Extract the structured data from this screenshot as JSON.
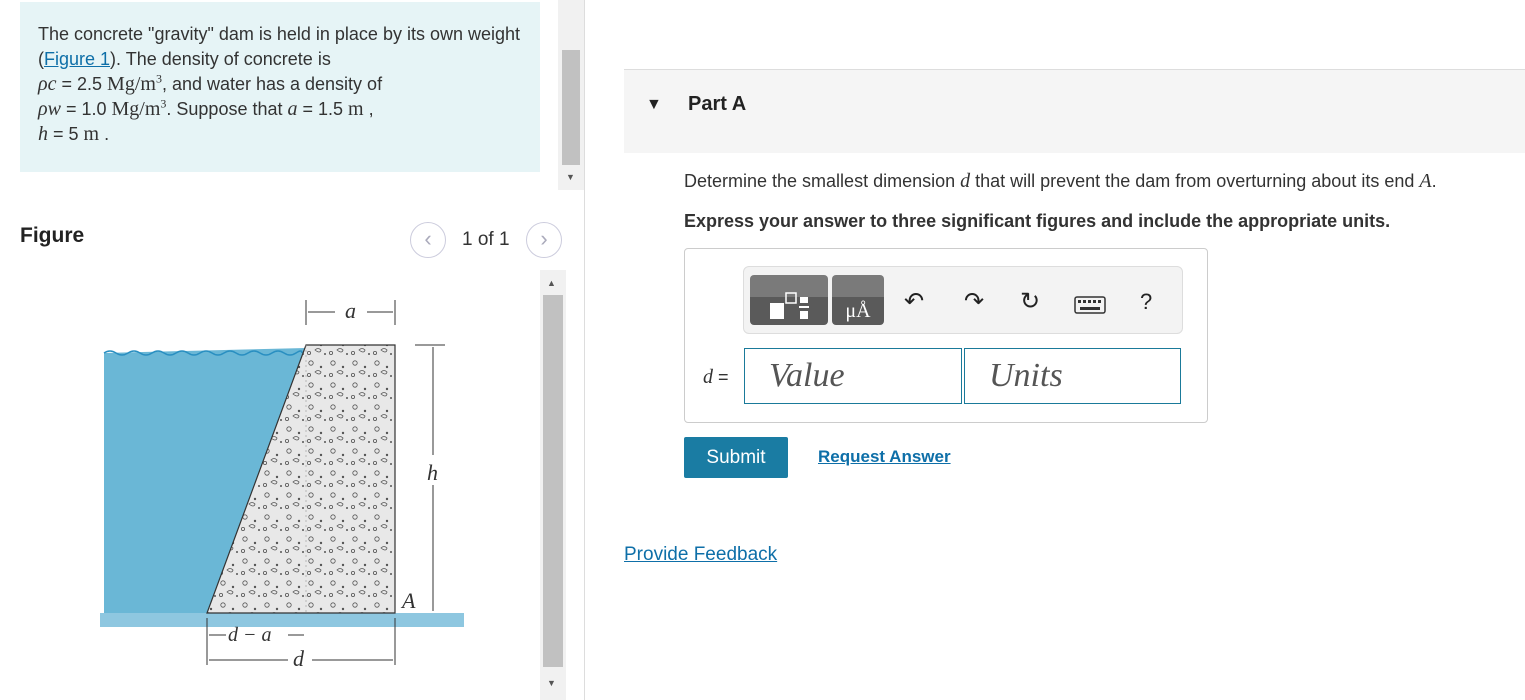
{
  "problem": {
    "text_1": "The concrete \"gravity\" dam is held in place by its own weight (",
    "figure_link": "Figure 1",
    "text_2": "). The density of concrete is",
    "rho_c_label": "ρc",
    "rho_c_value": " = 2.5 ",
    "rho_c_unit": "Mg/m",
    "rho_c_tail": ", and water has a density of",
    "rho_w_label": "ρw",
    "rho_w_value": " = 1.0 ",
    "rho_w_unit": "Mg/m",
    "rho_w_tail": ". Suppose that ",
    "a_var": "a",
    "a_value": " = 1.5 ",
    "a_unit": "m",
    "a_tail": " ,",
    "h_var": "h",
    "h_value": " = 5 ",
    "h_unit": "m",
    "h_tail": " ."
  },
  "figure": {
    "title": "Figure",
    "prev_icon": "chevron-left-icon",
    "next_icon": "chevron-right-icon",
    "page_count": "1 of 1",
    "labels": {
      "a": "a",
      "h": "h",
      "A": "A",
      "d_minus_a": "d − a",
      "d": "d"
    }
  },
  "part": {
    "toggle_icon": "caret-down-icon",
    "title": "Part A",
    "question_1": "Determine the smallest dimension ",
    "question_var": "d",
    "question_2": " that will prevent the dam from overturning about its end ",
    "question_end": "A",
    "question_3": ".",
    "instruction": "Express your answer to three significant figures and include the appropriate units."
  },
  "answer": {
    "variable": "d",
    "equals": " =",
    "value_placeholder": "Value",
    "units_placeholder": "Units",
    "toolbar": {
      "units_button_glyph": "μÅ",
      "undo_icon": "undo-icon",
      "redo_icon": "redo-icon",
      "reset_icon": "reset-icon",
      "keyboard_icon": "keyboard-icon",
      "help": "?"
    }
  },
  "actions": {
    "submit": "Submit",
    "request_answer": "Request Answer",
    "feedback": "Provide Feedback"
  },
  "colors": {
    "problem_bg": "#e6f4f6",
    "link": "#0e6fa8",
    "submit_bg": "#1a7ca3",
    "water": "#6ab7d6",
    "ground": "#8ec7e0"
  }
}
